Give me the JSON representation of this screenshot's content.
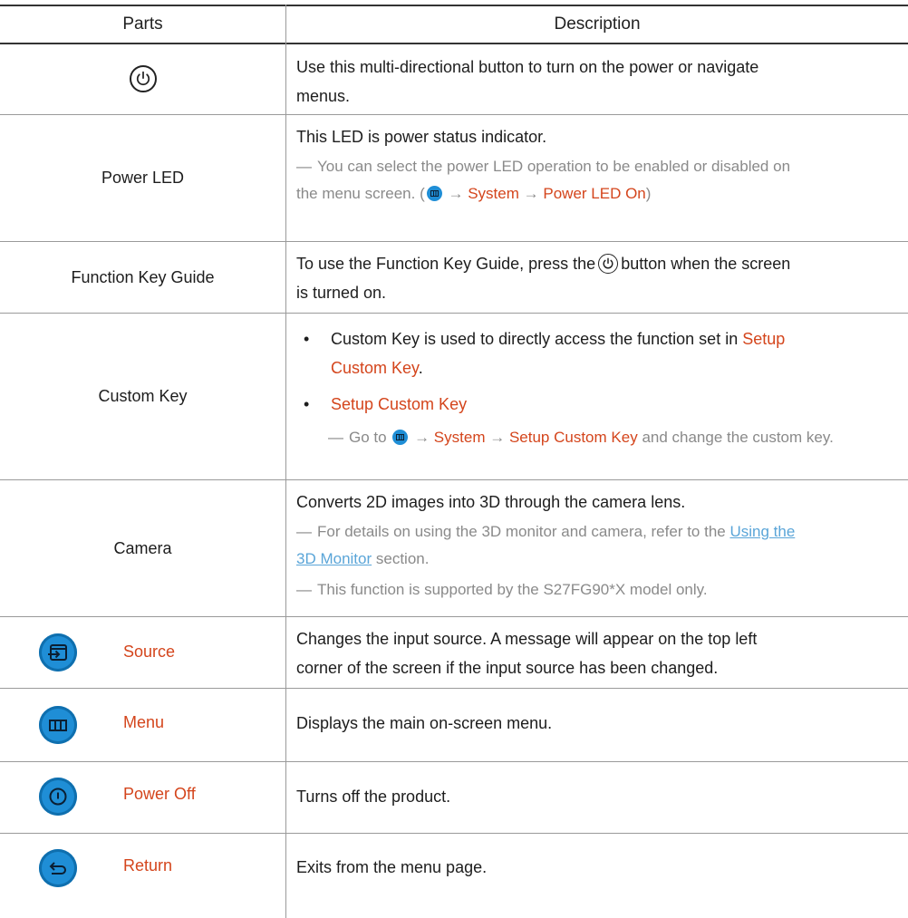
{
  "header": {
    "parts": "Parts",
    "description": "Description"
  },
  "rows": {
    "joystick": {
      "icon": "power-button-icon",
      "line1": "Use this multi-directional button to turn on the power or navigate",
      "line2": "menus."
    },
    "power_led": {
      "part": "Power LED",
      "desc": "This LED is power status indicator.",
      "note_line1": "You can select the power LED operation to be enabled or disabled on",
      "note_line2_pre": "the menu screen. (",
      "note_arrow1": "→",
      "note_system": "System",
      "note_arrow2": "→",
      "note_power_led_on": "Power LED On",
      "note_close": ")"
    },
    "function_key_guide": {
      "part": "Function Key Guide",
      "line1_pre": "To use the Function Key Guide, press the",
      "line1_post": "button when the screen",
      "line2": "is turned on."
    },
    "custom_key": {
      "part": "Custom Key",
      "bullet": "•",
      "b1_line1": "Custom Key is used to directly access the function set in",
      "b1_hl1": "Setup",
      "b1_hl2": "Custom Key",
      "b1_end": ".",
      "b2": "Setup Custom Key",
      "note_pre": "Go to",
      "arrow1": "→",
      "system": "System",
      "arrow2": "→",
      "setup_custom_key": "Setup Custom Key",
      "note_post": "and change the custom key."
    },
    "camera": {
      "part": "Camera",
      "desc": "Converts 2D images into 3D through the camera lens.",
      "note1_pre": "For details on using the 3D monitor and camera, refer to the",
      "note1_link1": "Using the",
      "note1_link2": "3D Monitor",
      "note1_post": "section.",
      "note2": "This function is supported by the S27FG90*X model only."
    },
    "source": {
      "label": "Source",
      "icon": "source-input-icon",
      "line1": "Changes the input source. A message will appear on the top left",
      "line2": "corner of the screen if the input source has been changed."
    },
    "menu": {
      "label": "Menu",
      "icon": "menu-grid-icon",
      "desc": "Displays the main on-screen menu."
    },
    "power_off": {
      "label": "Power Off",
      "icon": "power-off-icon",
      "desc": "Turns off the product."
    },
    "return": {
      "label": "Return",
      "icon": "return-arrow-icon",
      "desc": "Exits from the menu page."
    }
  },
  "note_dash": "―",
  "colors": {
    "highlight": "#d4451c",
    "link": "#5aa5d8",
    "button": "#1f8ed6",
    "note": "#8a8a8a"
  }
}
